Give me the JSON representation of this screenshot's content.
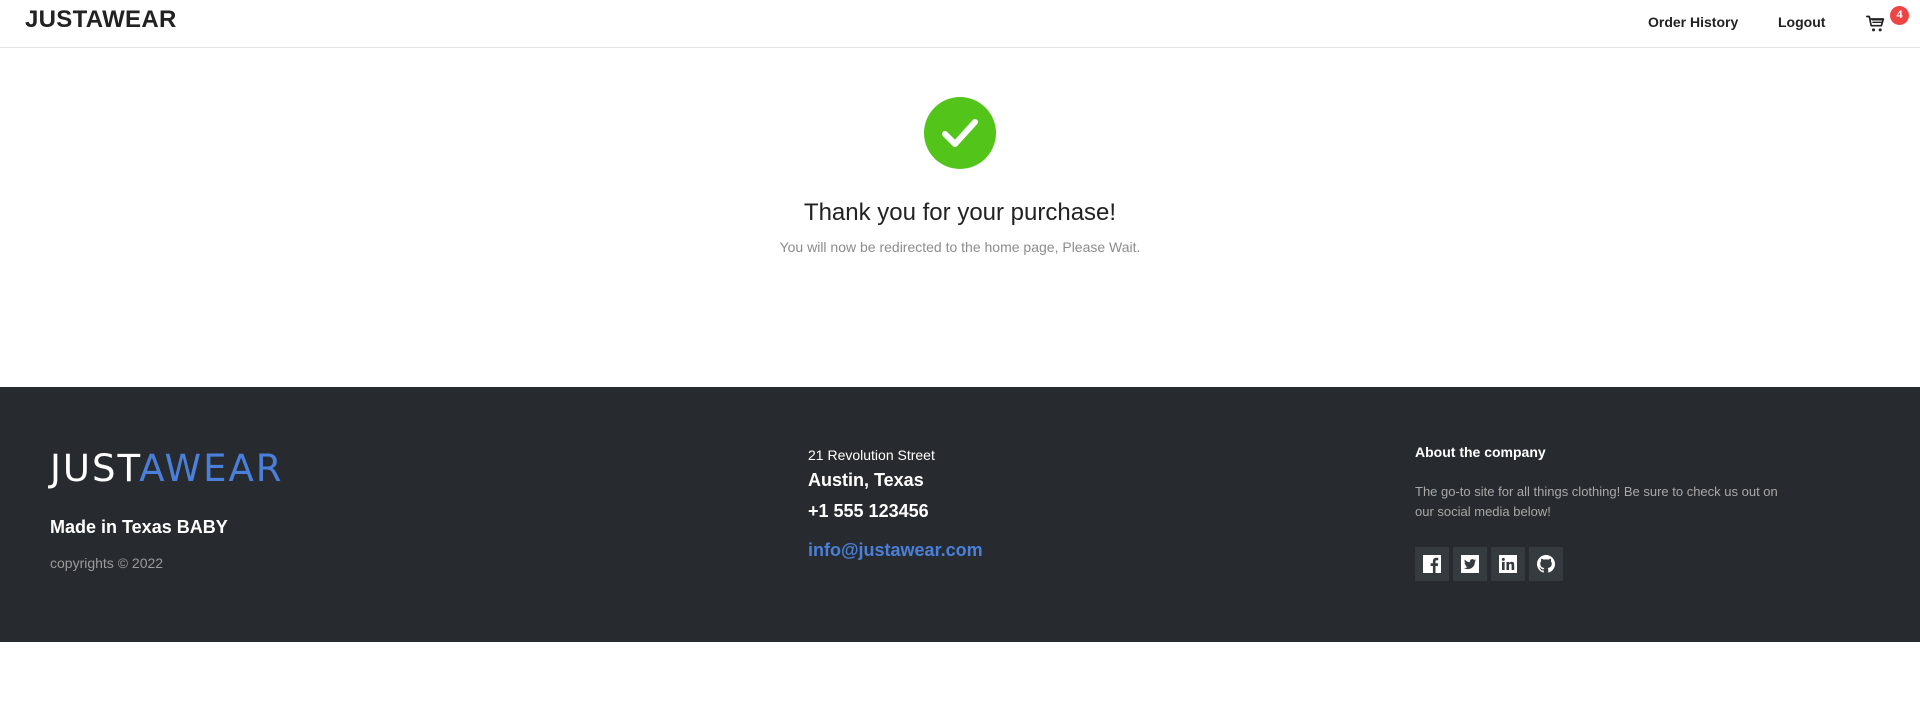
{
  "header": {
    "brand": "JUSTAWEAR",
    "nav": {
      "order_history": "Order History",
      "logout": "Logout"
    },
    "cart": {
      "icon": "cart-icon",
      "badge_count": "4"
    }
  },
  "confirmation": {
    "icon": "check-circle-icon",
    "title": "Thank you for your purchase!",
    "subtitle": "You will now be redirected to the home page, Please Wait."
  },
  "footer": {
    "logo_part1": "JUST",
    "logo_part2": "AWEAR",
    "tagline": "Made in Texas BABY",
    "copyright": "copyrights © 2022",
    "address": {
      "street": "21 Revolution Street",
      "city": "Austin, Texas",
      "phone": "+1 555 123456",
      "email": "info@justawear.com"
    },
    "about": {
      "title": "About the company",
      "text": "The go-to site for all things clothing! Be sure to check us out on our social media below!"
    },
    "social": [
      "facebook-icon",
      "twitter-icon",
      "linkedin-icon",
      "github-icon"
    ]
  },
  "colors": {
    "success": "#52c41a",
    "badge": "#ef4444",
    "accent_blue": "#4a80d9",
    "footer_bg": "#272b2f"
  }
}
